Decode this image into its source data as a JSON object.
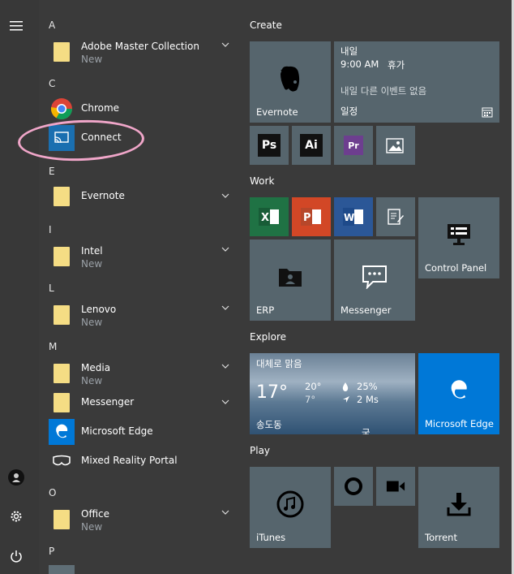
{
  "sidebar": {
    "items": [
      "hamburger-icon",
      "user-avatar-icon",
      "settings-gear-icon",
      "power-icon"
    ]
  },
  "applist": {
    "groups": [
      {
        "letter": "A",
        "apps": [
          {
            "name": "Adobe Master Collection",
            "sub": "New",
            "icon": "folder-icon",
            "expandable": true
          }
        ]
      },
      {
        "letter": "C",
        "apps": [
          {
            "name": "Chrome",
            "icon": "chrome-icon"
          },
          {
            "name": "Connect",
            "icon": "connect-icon"
          }
        ]
      },
      {
        "letter": "E",
        "apps": [
          {
            "name": "Evernote",
            "icon": "folder-icon",
            "expandable": true
          }
        ]
      },
      {
        "letter": "I",
        "apps": [
          {
            "name": "Intel",
            "sub": "New",
            "icon": "folder-icon",
            "expandable": true
          }
        ]
      },
      {
        "letter": "L",
        "apps": [
          {
            "name": "Lenovo",
            "sub": "New",
            "icon": "folder-icon",
            "expandable": true
          }
        ]
      },
      {
        "letter": "M",
        "apps": [
          {
            "name": "Media",
            "sub": "New",
            "icon": "folder-icon",
            "expandable": true
          },
          {
            "name": "Messenger",
            "icon": "folder-icon",
            "expandable": true
          },
          {
            "name": "Microsoft Edge",
            "icon": "edge-icon"
          },
          {
            "name": "Mixed Reality Portal",
            "icon": "mixed-reality-icon"
          }
        ]
      },
      {
        "letter": "O",
        "apps": [
          {
            "name": "Office",
            "sub": "New",
            "icon": "folder-icon",
            "expandable": true
          }
        ]
      },
      {
        "letter": "P",
        "apps": []
      }
    ]
  },
  "tiles": {
    "groups": {
      "create": "Create",
      "work": "Work",
      "explore": "Explore",
      "play": "Play"
    },
    "evernote": "Evernote",
    "calendar": {
      "day": "내일",
      "time": "9:00 AM",
      "event": "휴가",
      "next": "내일 다른 이벤트 없음",
      "label": "일정"
    },
    "control_panel": "Control Panel",
    "erp": "ERP",
    "messenger": "Messenger",
    "weather": {
      "city_header": "대체로 맑음",
      "temp": "17°",
      "high": "20°",
      "low": "7°",
      "humidity": "25%",
      "wind": "2 Ms",
      "location": "송도동",
      "extra": "국"
    },
    "edge": "Microsoft Edge",
    "itunes": "iTunes",
    "torrent": "Torrent"
  },
  "colors": {
    "excel": "#1f7244",
    "powerpoint": "#d24726",
    "word": "#2b5797",
    "edge_tile": "#0078d7",
    "tile": "#56656d",
    "annotation": "#f0a6c9"
  }
}
